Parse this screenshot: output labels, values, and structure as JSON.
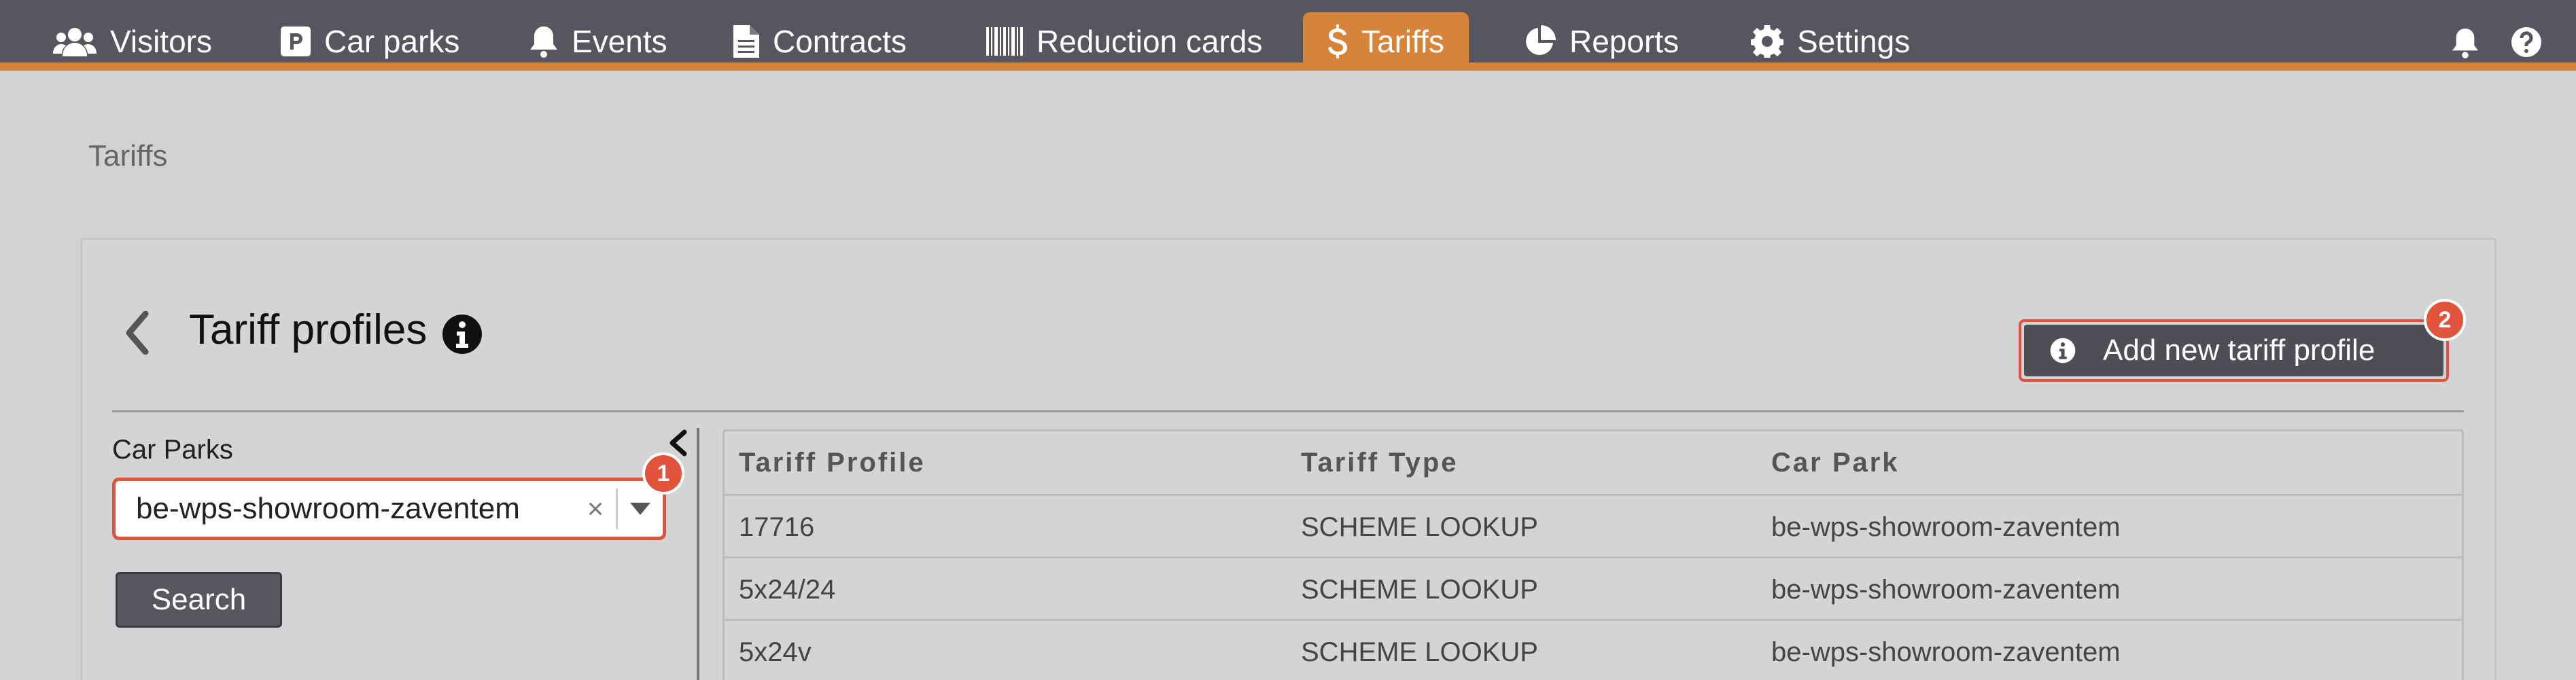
{
  "nav": {
    "items": [
      {
        "label": "Visitors",
        "icon": "users-icon"
      },
      {
        "label": "Car parks",
        "icon": "parking-icon"
      },
      {
        "label": "Events",
        "icon": "bell-icon"
      },
      {
        "label": "Contracts",
        "icon": "document-icon"
      },
      {
        "label": "Reduction cards",
        "icon": "barcode-icon"
      },
      {
        "label": "Tariffs",
        "icon": "dollar-icon",
        "active": true
      },
      {
        "label": "Reports",
        "icon": "pie-chart-icon"
      },
      {
        "label": "Settings",
        "icon": "gear-icon"
      }
    ],
    "right_icons": [
      "bell-icon",
      "help-icon"
    ]
  },
  "breadcrumb": "Tariffs",
  "card": {
    "title": "Tariff profiles",
    "add_button": "Add new tariff profile",
    "add_badge": "2"
  },
  "filter": {
    "label": "Car Parks",
    "selected": "be-wps-showroom-zaventem",
    "clear": "×",
    "badge": "1",
    "search_button": "Search"
  },
  "table": {
    "headers": [
      "Tariff Profile",
      "Tariff Type",
      "Car Park"
    ],
    "rows": [
      [
        "17716",
        "SCHEME LOOKUP",
        "be-wps-showroom-zaventem"
      ],
      [
        "5x24/24",
        "SCHEME LOOKUP",
        "be-wps-showroom-zaventem"
      ],
      [
        "5x24v",
        "SCHEME LOOKUP",
        "be-wps-showroom-zaventem"
      ]
    ]
  },
  "colors": {
    "nav_bg": "#55565f",
    "accent": "#d7843a",
    "badge": "#e1533b",
    "button_dark": "#4d4e56"
  }
}
